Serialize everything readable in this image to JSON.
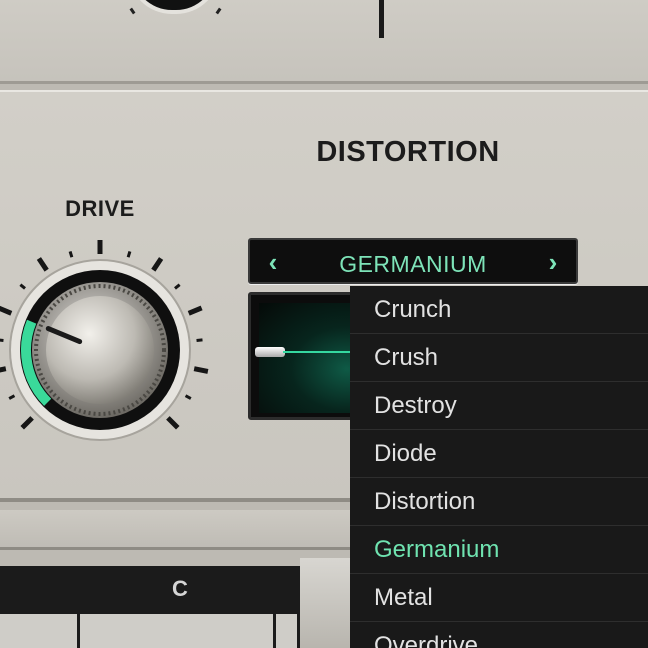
{
  "section_title": "DISTORTION",
  "drive": {
    "label": "DRIVE",
    "level": 0.25
  },
  "selector": {
    "prev_icon": "chevron-left-icon",
    "next_icon": "chevron-right-icon",
    "prev_glyph": "‹",
    "next_glyph": "›",
    "value": "GERMANIUM"
  },
  "dropdown": {
    "items": [
      {
        "label": "Crunch",
        "selected": false
      },
      {
        "label": "Crush",
        "selected": false
      },
      {
        "label": "Destroy",
        "selected": false
      },
      {
        "label": "Diode",
        "selected": false
      },
      {
        "label": "Distortion",
        "selected": false
      },
      {
        "label": "Germanium",
        "selected": true
      },
      {
        "label": "Metal",
        "selected": false
      },
      {
        "label": "Overdrive",
        "selected": false
      }
    ]
  },
  "bottom_label": "C",
  "colors": {
    "accent": "#6fe3b0",
    "panel": "#cdcac3",
    "dark": "#191919"
  }
}
